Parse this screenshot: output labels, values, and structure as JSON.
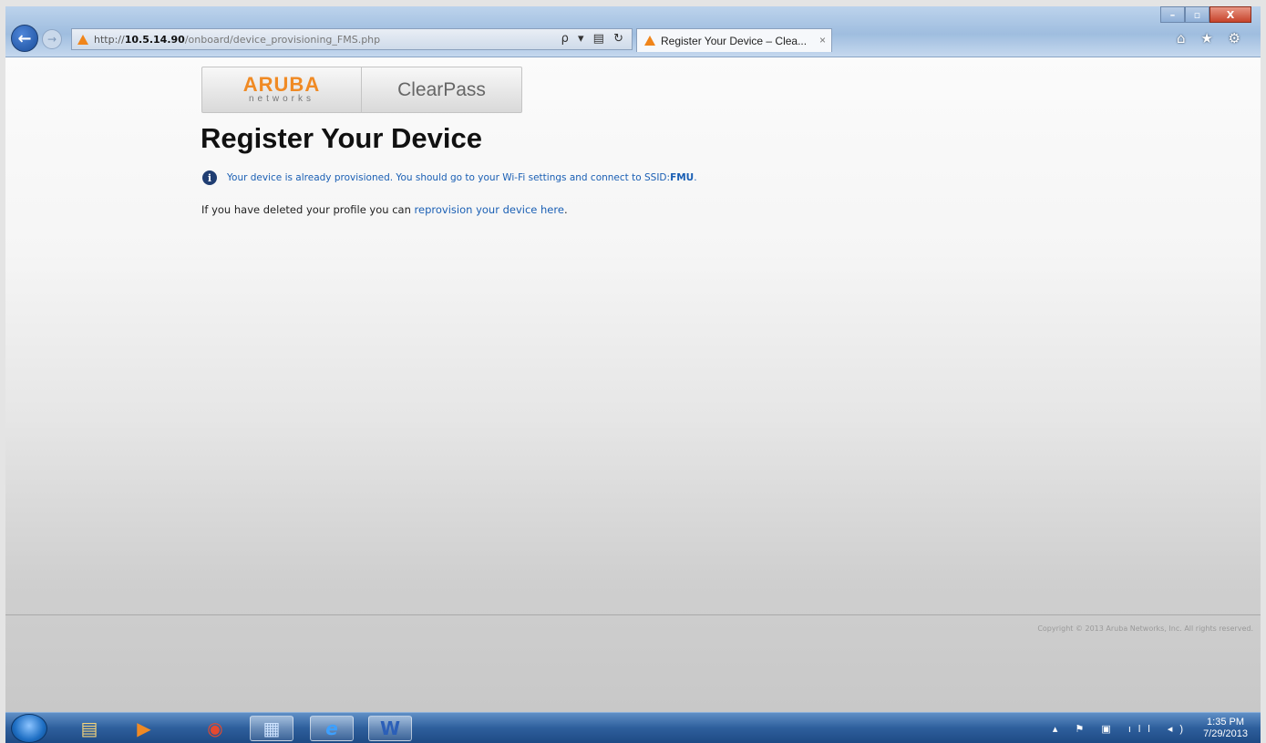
{
  "browser": {
    "url_prefix": "http://",
    "url_host": "10.5.14.90",
    "url_path": "/onboard/device_provisioning_FMS.php",
    "address_tools": "ρ ▾ ▤ ↻",
    "tab_title": "Register Your Device – Clea...",
    "tab_close": "×",
    "back_glyph": "←",
    "forward_glyph": "→",
    "window_buttons": {
      "minimize": "–",
      "maximize": "▫",
      "close": "X"
    },
    "toolbar_icons": "⌂ ★ ⚙"
  },
  "page": {
    "logo_aruba": "ARUBA",
    "logo_networks": "networks",
    "logo_product": "ClearPass",
    "title": "Register Your Device",
    "info_icon": "i",
    "info_message": "Your device is already provisioned. You should go to your Wi-Fi settings and connect to SSID: ",
    "info_ssid": "FMU",
    "info_end": ".",
    "reprovision_prefix": "If you have deleted your profile you can ",
    "reprovision_link": "reprovision your device here",
    "reprovision_suffix": ".",
    "copyright": "Copyright © 2013 Aruba Networks, Inc. All rights reserved."
  },
  "taskbar": {
    "apps": [
      {
        "name": "explorer",
        "glyph": "▤"
      },
      {
        "name": "media-player",
        "glyph": "▶"
      },
      {
        "name": "chrome",
        "glyph": "◉"
      },
      {
        "name": "control-panel",
        "glyph": "▦"
      },
      {
        "name": "internet-explorer",
        "glyph": "e"
      },
      {
        "name": "word",
        "glyph": "W"
      }
    ],
    "tray_icons": "▴ ⚑ ▣ ıll ◂)",
    "time": "1:35 PM",
    "date": "7/29/2013"
  },
  "colors": {
    "link": "#1a5fb4",
    "aruba_orange": "#f08a24",
    "chrome_blue": "#9fbddf"
  }
}
